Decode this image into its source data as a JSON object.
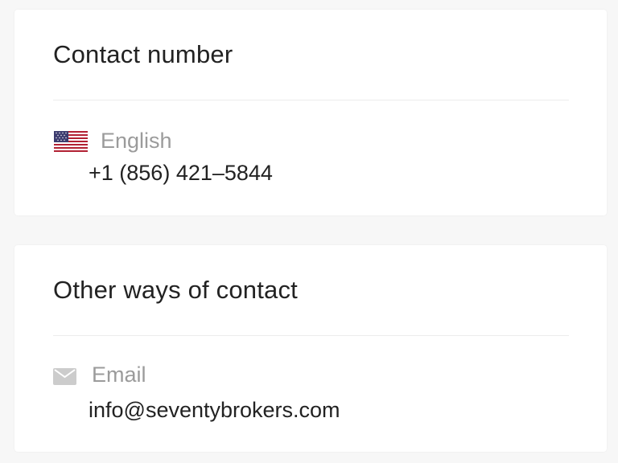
{
  "contact_number": {
    "title": "Contact number",
    "entries": [
      {
        "icon": "us-flag-icon",
        "label": "English",
        "value": "+1 (856) 421–5844"
      }
    ]
  },
  "other_contact": {
    "title": "Other ways of contact",
    "entries": [
      {
        "icon": "mail-icon",
        "label": "Email",
        "value": "info@seventybrokers.com"
      }
    ]
  },
  "colors": {
    "background": "#f7f7f7",
    "card": "#ffffff",
    "label": "#9b9b9b",
    "text": "#222222",
    "divider": "#ececec",
    "icon": "#cccccc"
  }
}
